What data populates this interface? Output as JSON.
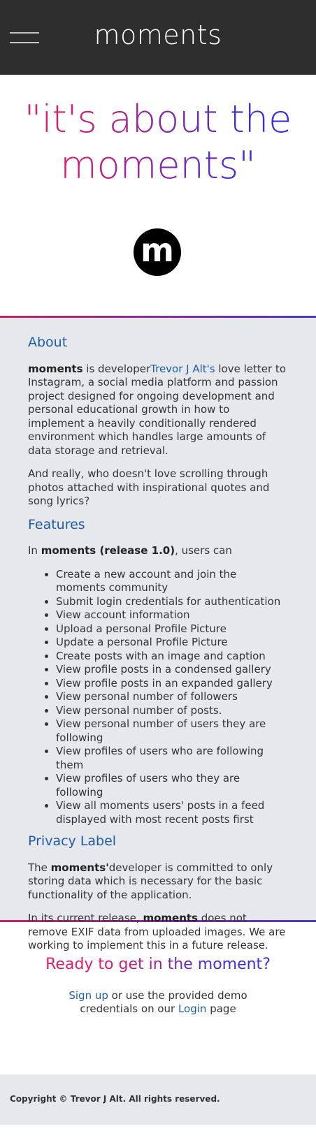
{
  "header": {
    "brand": "moments",
    "menu_icon": "hamburger-menu-icon"
  },
  "hero": {
    "tagline": "\"it's about the moments\"",
    "logo_letter": "m"
  },
  "about": {
    "heading": "About",
    "p1_bold": "moments",
    "p1_pre": " is developer",
    "p1_link": "Trevor J Alt's",
    "p1_post": " love letter to Instagram, a social media platform and passion project designed for ongoing development and personal educational growth in how to implement a heavily conditionally rendered environment which handles large amounts of data storage and retrieval.",
    "p2": "And really, who doesn't love scrolling through photos attached with inspirational quotes and song lyrics?"
  },
  "features": {
    "heading": "Features",
    "intro_pre": "In ",
    "intro_bold": "moments (release 1.0)",
    "intro_post": ", users can",
    "items": [
      "Create a new account and join the moments community",
      "Submit login credentials for authentication",
      "View account information",
      "Upload a personal Profile Picture",
      "Update a personal Profile Picture",
      "Create posts with an image and caption",
      "View profile posts in a condensed gallery",
      "View profile posts in an expanded gallery",
      "View personal number of followers",
      "View personal number of posts.",
      "View personal number of users they are following",
      "View profiles of users who are following them",
      "View profiles of users who they are following",
      "View all moments users' posts in a feed displayed with most recent posts first"
    ]
  },
  "privacy": {
    "heading": "Privacy Label",
    "p1_pre": "The ",
    "p1_bold": "moments'",
    "p1_post": "developer is committed to only storing data which is necessary for the basic functionality of the application.",
    "p2_pre": "In its current release, ",
    "p2_bold": "moments",
    "p2_post": " does not remove EXIF data from uploaded images. We are working to implement this in a future release."
  },
  "cta": {
    "title": "Ready to get in the moment?",
    "signup_link": "Sign up",
    "mid_text": " or use the provided demo credentials on our ",
    "login_link": "Login",
    "end_text": " page"
  },
  "footer": {
    "copyright": "Copyright © Trevor J Alt. All rights reserved."
  },
  "colors": {
    "header_bg": "#2e2e2e",
    "accent_pink": "#de1c6a",
    "accent_purple": "#3b2de0",
    "link_blue": "#1f5ba8",
    "section_bg": "#e7e8eb"
  }
}
